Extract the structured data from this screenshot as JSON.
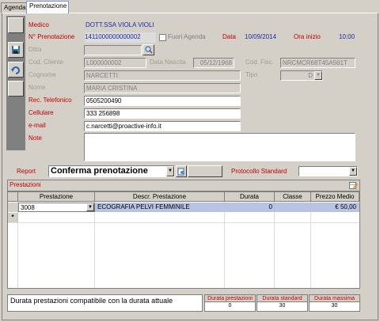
{
  "tabs": [
    {
      "label": "Agenda",
      "active": false
    },
    {
      "label": "Prenotazione",
      "active": true
    }
  ],
  "form": {
    "medico_label": "Medico",
    "medico_value": "DOTT.SSA VIOLA VIOLI",
    "nprenotazione_label": "N° Prenotazione",
    "nprenotazione_value": "1411000000000002",
    "fuori_agenda_label": "Fuori Agenda",
    "data_label": "Data",
    "data_value": "10/09/2014",
    "ora_inizio_label": "Ora inizio",
    "ora_inizio_value": "10:00",
    "ditta_label": "Ditta",
    "ditta_value": "",
    "cod_cliente_label": "Cod. Cliente",
    "cod_cliente_value": "L000000002",
    "data_nascita_label": "Data Nascita",
    "data_nascita_value": "05/12/1968",
    "cod_fisc_label": "Cod. Fisc.",
    "cod_fisc_value": "NRCMCR68T45A561T",
    "cognome_label": "Cognome",
    "cognome_value": "NARCETTI",
    "tipo_label": "Tipo",
    "tipo_value": "D",
    "nome_label": "Nome",
    "nome_value": "MARIA CRISTINA",
    "telefono_label": "Rec. Telefonico",
    "telefono_value": "0505200490",
    "cellulare_label": "Cellulare",
    "cellulare_value": "333 256898",
    "email_label": "e-mail",
    "email_value": "c.narcetti@proactive-info.it",
    "note_label": "Note",
    "note_value": ""
  },
  "report": {
    "label": "Report",
    "value": "Conferma prenotazione",
    "protocollo_label": "Protocollo Standard",
    "protocollo_value": ""
  },
  "prestazioni": {
    "title": "Prestazioni",
    "columns": [
      "Prestazione",
      "Descr. Prestazione",
      "Durata",
      "Classe",
      "Prezzo Medio"
    ],
    "rows": [
      {
        "prestazione": "3008",
        "descr": "ECOGRAFIA PELVI FEMMINILE",
        "durata": "0",
        "classe": "",
        "prezzo": "€ 50,00"
      }
    ],
    "new_row_marker": "*"
  },
  "summary": {
    "message": "Durata prestazioni compatibile con la durata attuale",
    "durata_prestazioni_label": "Durata prestazioni",
    "durata_prestazioni_value": "0",
    "durata_standard_label": "Durata standard",
    "durata_standard_value": "30",
    "durata_massima_label": "Durata massima",
    "durata_massima_value": "30"
  },
  "colors": {
    "label_red": "#c00000",
    "value_blue": "#1c2aa8",
    "selected_row": "#b9c3e3"
  }
}
